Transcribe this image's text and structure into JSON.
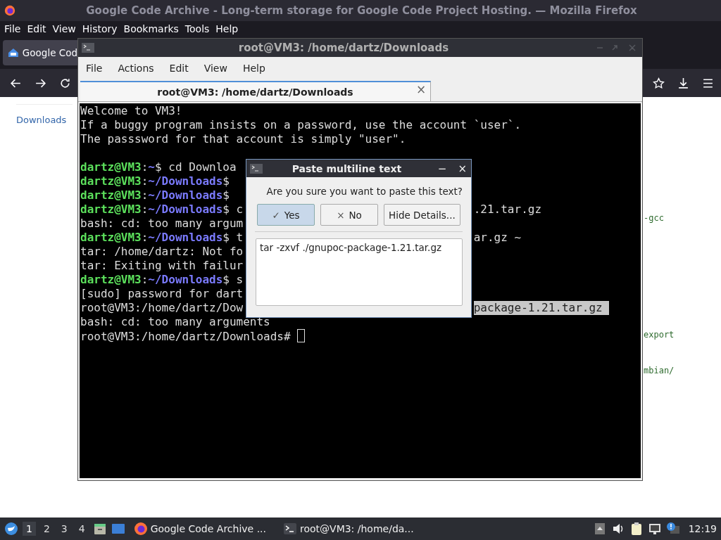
{
  "browser": {
    "title": "Google Code Archive - Long-term storage for Google Code Project Hosting. — Mozilla Firefox",
    "menu": [
      "File",
      "Edit",
      "View",
      "History",
      "Bookmarks",
      "Tools",
      "Help"
    ],
    "tab": {
      "label": "Google Cod",
      "selected": true
    },
    "sidebar_link": "Downloads",
    "page_fragments": [
      "-gcc",
      "export",
      "mbian/"
    ]
  },
  "terminal": {
    "title": "root@VM3: /home/dartz/Downloads",
    "menu": [
      "File",
      "Actions",
      "Edit",
      "View",
      "Help"
    ],
    "tab": {
      "label": "root@VM3: /home/dartz/Downloads",
      "close": "×"
    },
    "blocks": [
      [
        {
          "segments": [
            {
              "kind": "text",
              "text": "Welcome to VM3!"
            }
          ]
        },
        {
          "segments": [
            {
              "kind": "text",
              "text": "If a buggy program insists on a password, use the account `user`."
            }
          ]
        },
        {
          "segments": [
            {
              "kind": "text",
              "text": "The passsword for that account is simply \"user\"."
            }
          ]
        }
      ],
      [
        {
          "segments": [
            {
              "kind": "user",
              "text": "dartz@VM3"
            },
            {
              "kind": "text",
              "text": ":"
            },
            {
              "kind": "path",
              "text": "~"
            },
            {
              "kind": "text",
              "text": "$ cd Downloa"
            }
          ]
        },
        {
          "segments": [
            {
              "kind": "user",
              "text": "dartz@VM3"
            },
            {
              "kind": "text",
              "text": ":"
            },
            {
              "kind": "path",
              "text": "~/Downloads"
            },
            {
              "kind": "text",
              "text": "$"
            }
          ]
        },
        {
          "segments": [
            {
              "kind": "user",
              "text": "dartz@VM3"
            },
            {
              "kind": "text",
              "text": ":"
            },
            {
              "kind": "path",
              "text": "~/Downloads"
            },
            {
              "kind": "text",
              "text": "$"
            }
          ]
        },
        {
          "segments": [
            {
              "kind": "user",
              "text": "dartz@VM3"
            },
            {
              "kind": "text",
              "text": ":"
            },
            {
              "kind": "path",
              "text": "~/Downloads"
            },
            {
              "kind": "text",
              "text": "$ c"
            }
          ],
          "right": {
            "text": ".21.tar.gz",
            "selected": false
          }
        },
        {
          "segments": [
            {
              "kind": "text",
              "text": "bash: cd: too many argum"
            }
          ]
        },
        {
          "segments": [
            {
              "kind": "user",
              "text": "dartz@VM3"
            },
            {
              "kind": "text",
              "text": ":"
            },
            {
              "kind": "path",
              "text": "~/Downloads"
            },
            {
              "kind": "text",
              "text": "$ t"
            }
          ],
          "right": {
            "text": "ar.gz ~",
            "selected": false
          }
        },
        {
          "segments": [
            {
              "kind": "text",
              "text": "tar: /home/dartz: Not fo"
            }
          ]
        },
        {
          "segments": [
            {
              "kind": "text",
              "text": "tar: Exiting with failur"
            }
          ]
        },
        {
          "segments": [
            {
              "kind": "user",
              "text": "dartz@VM3"
            },
            {
              "kind": "text",
              "text": ":"
            },
            {
              "kind": "path",
              "text": "~/Downloads"
            },
            {
              "kind": "text",
              "text": "$ s"
            }
          ]
        },
        {
          "segments": [
            {
              "kind": "text",
              "text": "[sudo] password for dart"
            }
          ]
        },
        {
          "segments": [
            {
              "kind": "text",
              "text": "root@VM3:/home/dartz/Dow"
            }
          ],
          "right": {
            "text": "package-1.21.tar.gz ",
            "selected": true
          }
        },
        {
          "segments": [
            {
              "kind": "text",
              "text": "bash: cd: too many arguments"
            }
          ]
        },
        {
          "segments": [
            {
              "kind": "text",
              "text": "root@VM3:/home/dartz/Downloads# "
            }
          ],
          "cursor": true
        }
      ]
    ]
  },
  "dialog": {
    "title": "Paste multiline text",
    "minimize": "−",
    "close": "×",
    "question": "Are you sure you want to paste this text?",
    "buttons": [
      {
        "label": "Yes",
        "mark": "✓",
        "selected": true
      },
      {
        "label": "No",
        "mark": "×",
        "selected": false
      },
      {
        "label": "Hide Details...",
        "selected": false
      }
    ],
    "text": "tar -zxvf ./gnupoc-package-1.21.tar.gz"
  },
  "taskbar": {
    "workspaces": [
      {
        "label": "1",
        "selected": true
      },
      {
        "label": "2",
        "selected": false
      },
      {
        "label": "3",
        "selected": false
      },
      {
        "label": "4",
        "selected": false
      }
    ],
    "tasks": [
      {
        "kind": "firefox",
        "label": "Google Code Archive ..."
      },
      {
        "kind": "terminal",
        "label": "root@VM3: /home/da..."
      }
    ],
    "clock": "12:19"
  }
}
